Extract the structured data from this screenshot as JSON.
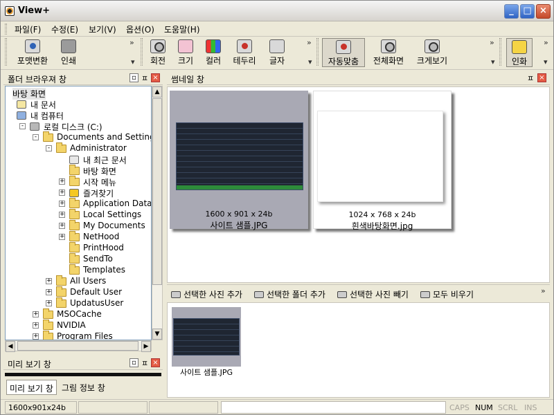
{
  "window": {
    "title": "View+"
  },
  "menu": [
    "파일(F)",
    "수정(E)",
    "보기(V)",
    "옵션(O)",
    "도움말(H)"
  ],
  "toolbar": {
    "group1": [
      {
        "label": "포맷변환",
        "icon": "format-convert-icon"
      },
      {
        "label": "인쇄",
        "icon": "printer-icon"
      }
    ],
    "group2": [
      {
        "label": "회전",
        "icon": "rotate-icon"
      },
      {
        "label": "크기",
        "icon": "resize-icon"
      },
      {
        "label": "컬러",
        "icon": "color-icon"
      },
      {
        "label": "테두리",
        "icon": "border-icon"
      },
      {
        "label": "글자",
        "icon": "text-icon"
      }
    ],
    "group3": [
      {
        "label": "자동맞춤",
        "icon": "autofit-icon",
        "pressed": true
      },
      {
        "label": "전체화면",
        "icon": "fullscreen-icon"
      },
      {
        "label": "크게보기",
        "icon": "zoom-icon"
      }
    ],
    "group4": [
      {
        "label": "인화",
        "icon": "photo-print-icon"
      }
    ]
  },
  "folder_pane": {
    "title": "폴더 브라우져 창",
    "tree": [
      {
        "label": "바탕 화면",
        "level": 0,
        "icon": "none",
        "expander": "",
        "selected": true
      },
      {
        "label": "내 문서",
        "level": 0,
        "icon": "doc",
        "expander": ""
      },
      {
        "label": "내 컴퓨터",
        "level": 0,
        "icon": "pc",
        "expander": ""
      },
      {
        "label": "로컬 디스크 (C:)",
        "level": 1,
        "icon": "disk",
        "expander": "-"
      },
      {
        "label": "Documents and Settings",
        "level": 2,
        "icon": "folder",
        "expander": "-"
      },
      {
        "label": "Administrator",
        "level": 3,
        "icon": "folder",
        "expander": "-"
      },
      {
        "label": "내 최근 문서",
        "level": 4,
        "icon": "recent",
        "expander": ""
      },
      {
        "label": "바탕 화면",
        "level": 4,
        "icon": "folder",
        "expander": ""
      },
      {
        "label": "시작 메뉴",
        "level": 4,
        "icon": "folder",
        "expander": "+"
      },
      {
        "label": "즐겨찾기",
        "level": 4,
        "icon": "star",
        "expander": "+"
      },
      {
        "label": "Application Data",
        "level": 4,
        "icon": "folder",
        "expander": "+"
      },
      {
        "label": "Local Settings",
        "level": 4,
        "icon": "folder",
        "expander": "+"
      },
      {
        "label": "My Documents",
        "level": 4,
        "icon": "folder",
        "expander": "+"
      },
      {
        "label": "NetHood",
        "level": 4,
        "icon": "folder",
        "expander": "+"
      },
      {
        "label": "PrintHood",
        "level": 4,
        "icon": "folder",
        "expander": ""
      },
      {
        "label": "SendTo",
        "level": 4,
        "icon": "folder",
        "expander": ""
      },
      {
        "label": "Templates",
        "level": 4,
        "icon": "folder",
        "expander": ""
      },
      {
        "label": "All Users",
        "level": 3,
        "icon": "folder",
        "expander": "+"
      },
      {
        "label": "Default User",
        "level": 3,
        "icon": "folder",
        "expander": "+"
      },
      {
        "label": "UpdatusUser",
        "level": 3,
        "icon": "folder",
        "expander": "+"
      },
      {
        "label": "MSOCache",
        "level": 2,
        "icon": "folder",
        "expander": "+"
      },
      {
        "label": "NVIDIA",
        "level": 2,
        "icon": "folder",
        "expander": "+"
      },
      {
        "label": "Program Files",
        "level": 2,
        "icon": "folder",
        "expander": "+"
      }
    ]
  },
  "preview_pane": {
    "title": "미리 보기 창",
    "tabs": [
      "미리 보기 창",
      "그림 정보 창"
    ]
  },
  "thumbnail_pane": {
    "title": "썸네일 창",
    "items": [
      {
        "dims": "1600 x 901 x 24b",
        "name": "사이트 샘플.JPG",
        "selected": true
      },
      {
        "dims": "1024 x 768 x 24b",
        "name": "흰색바탕화면.jpg",
        "selected": false
      }
    ]
  },
  "selection_panel": {
    "actions": [
      "선택한 사진 추가",
      "선택한 폴더 추가",
      "선택한 사진 빼기",
      "모두 비우기"
    ],
    "items": [
      {
        "name": "사이트 샘플.JPG"
      }
    ]
  },
  "status": {
    "info": "1600x901x24b",
    "indicators": [
      {
        "label": "CAPS",
        "active": false
      },
      {
        "label": "NUM",
        "active": true
      },
      {
        "label": "SCRL",
        "active": false
      },
      {
        "label": "INS",
        "active": false
      }
    ]
  },
  "colors": {
    "thumbnail_selected_bg": "#a9a9b4",
    "dark_image_bg": "#1f2632",
    "close_red": "#e45b45"
  }
}
